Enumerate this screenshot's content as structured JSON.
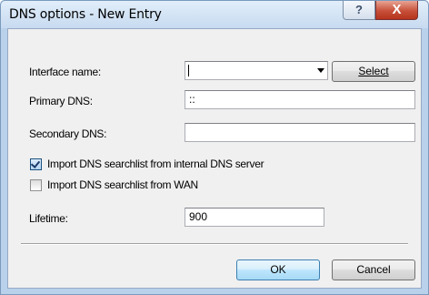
{
  "window": {
    "title": "DNS options - New Entry",
    "help_label": "?",
    "close_label": "X"
  },
  "form": {
    "interface_name_label": "Interface name:",
    "interface_name_value": "",
    "select_button_label": "Select",
    "primary_dns_label": "Primary DNS:",
    "primary_dns_value": "::",
    "secondary_dns_label": "Secondary DNS:",
    "secondary_dns_value": "",
    "import_internal_label": "Import DNS searchlist from internal DNS server",
    "import_internal_checked": true,
    "import_wan_label": "Import DNS searchlist from WAN",
    "import_wan_checked": false,
    "lifetime_label": "Lifetime:",
    "lifetime_value": "900"
  },
  "buttons": {
    "ok_label": "OK",
    "cancel_label": "Cancel"
  }
}
